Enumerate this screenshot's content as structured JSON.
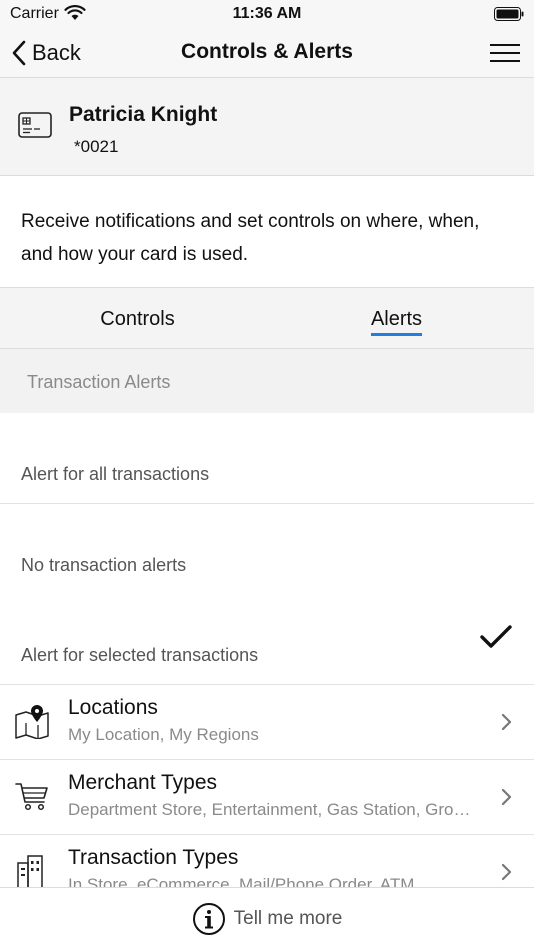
{
  "status_bar": {
    "carrier": "Carrier",
    "time": "11:36 AM"
  },
  "nav": {
    "back_label": "Back",
    "title": "Controls & Alerts"
  },
  "card": {
    "name": "Patricia Knight",
    "number": "*0021"
  },
  "description": "Receive notifications and set controls on where, when, and how your card is used.",
  "tabs": [
    {
      "label": "Controls",
      "active": false
    },
    {
      "label": "Alerts",
      "active": true
    }
  ],
  "accent_color": "#1e7fe0",
  "section_header": "Transaction Alerts",
  "alert_options": [
    {
      "label": "Alert for all transactions",
      "selected": false
    },
    {
      "label": "No transaction alerts",
      "selected": false
    },
    {
      "label": "Alert for selected transactions",
      "selected": true
    }
  ],
  "rows": [
    {
      "icon": "map-pin-icon",
      "title": "Locations",
      "subtitle": "My Location, My Regions"
    },
    {
      "icon": "shopping-cart-icon",
      "title": "Merchant Types",
      "subtitle": "Department Store, Entertainment, Gas Station, Groceries, Household, Personal Care, Restaurant"
    },
    {
      "icon": "buildings-icon",
      "title": "Transaction Types",
      "subtitle": "In Store, eCommerce, Mail/Phone Order, ATM"
    }
  ],
  "footer": {
    "label": "Tell me more"
  }
}
